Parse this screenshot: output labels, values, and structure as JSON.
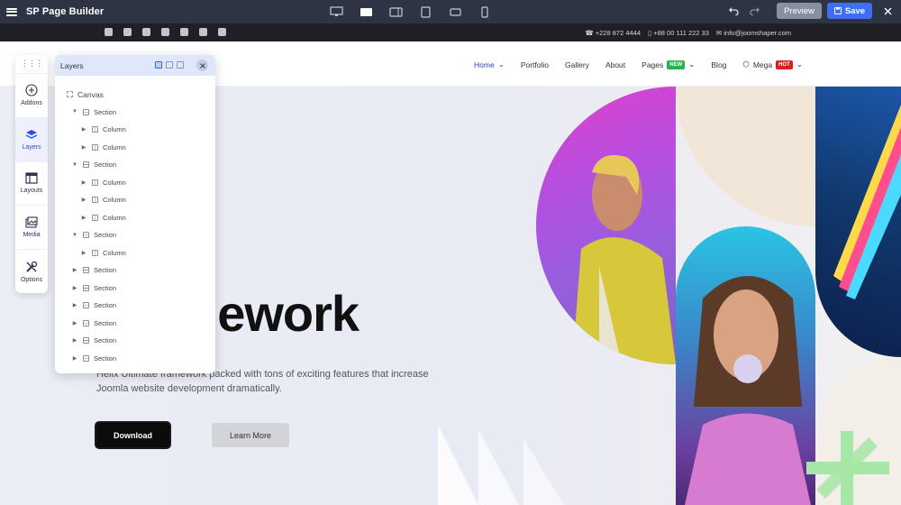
{
  "app": {
    "title": "SP Page Builder",
    "preview_label": "Preview",
    "save_label": "Save"
  },
  "devices": [
    "desktop-monitor-icon",
    "laptop-icon",
    "tablet-landscape-icon",
    "tablet-portrait-icon",
    "mobile-landscape-icon",
    "mobile-portrait-icon"
  ],
  "topinfo": {
    "social": [
      "facebook-icon",
      "twitter-icon",
      "pinterest-icon",
      "youtube-icon",
      "linkedin-icon",
      "instagram-icon",
      "flickr-icon"
    ],
    "phone1": "+228 872 4444",
    "phone2": "+88 00 111 222 33",
    "email": "info@joomshaper.com"
  },
  "nav": {
    "items": [
      {
        "label": "Home",
        "active": true,
        "dropdown": true
      },
      {
        "label": "Portfolio"
      },
      {
        "label": "Gallery"
      },
      {
        "label": "About"
      },
      {
        "label": "Pages",
        "badge": "NEW",
        "badge_color": "#2bb24c",
        "dropdown": true
      },
      {
        "label": "Blog"
      },
      {
        "label": "Mega",
        "badge": "HOT",
        "badge_color": "#d62020",
        "dropdown": true
      }
    ]
  },
  "hero": {
    "headline_fragment": "nework",
    "k_fragment": "k",
    "paragraph": "Helix Ultimate framework packed with tons of exciting features that increase Joomla website development dramatically.",
    "download_label": "Download",
    "learn_label": "Learn More"
  },
  "sidebar": {
    "items": [
      {
        "label": "Addons",
        "icon": "plus-circle-icon"
      },
      {
        "label": "Layers",
        "icon": "layers-icon",
        "active": true
      },
      {
        "label": "Layouts",
        "icon": "layout-icon"
      },
      {
        "label": "Media",
        "icon": "media-icon"
      },
      {
        "label": "Options",
        "icon": "tools-icon"
      }
    ]
  },
  "layers": {
    "title": "Layers",
    "tree": [
      {
        "label": "Canvas",
        "type": "canvas",
        "indent": 0
      },
      {
        "label": "Section",
        "type": "sec",
        "indent": 1,
        "open": true
      },
      {
        "label": "Column",
        "type": "col",
        "indent": 2
      },
      {
        "label": "Column",
        "type": "col",
        "indent": 2
      },
      {
        "label": "Section",
        "type": "sec",
        "indent": 1,
        "open": true
      },
      {
        "label": "Column",
        "type": "col",
        "indent": 2
      },
      {
        "label": "Column",
        "type": "col",
        "indent": 2
      },
      {
        "label": "Column",
        "type": "col",
        "indent": 2
      },
      {
        "label": "Section",
        "type": "sec",
        "indent": 1,
        "open": true
      },
      {
        "label": "Column",
        "type": "col",
        "indent": 2
      },
      {
        "label": "Section",
        "type": "sec",
        "indent": 1
      },
      {
        "label": "Section",
        "type": "sec",
        "indent": 1
      },
      {
        "label": "Section",
        "type": "sec",
        "indent": 1
      },
      {
        "label": "Section",
        "type": "sec",
        "indent": 1
      },
      {
        "label": "Section",
        "type": "sec",
        "indent": 1
      },
      {
        "label": "Section",
        "type": "sec",
        "indent": 1
      }
    ]
  }
}
